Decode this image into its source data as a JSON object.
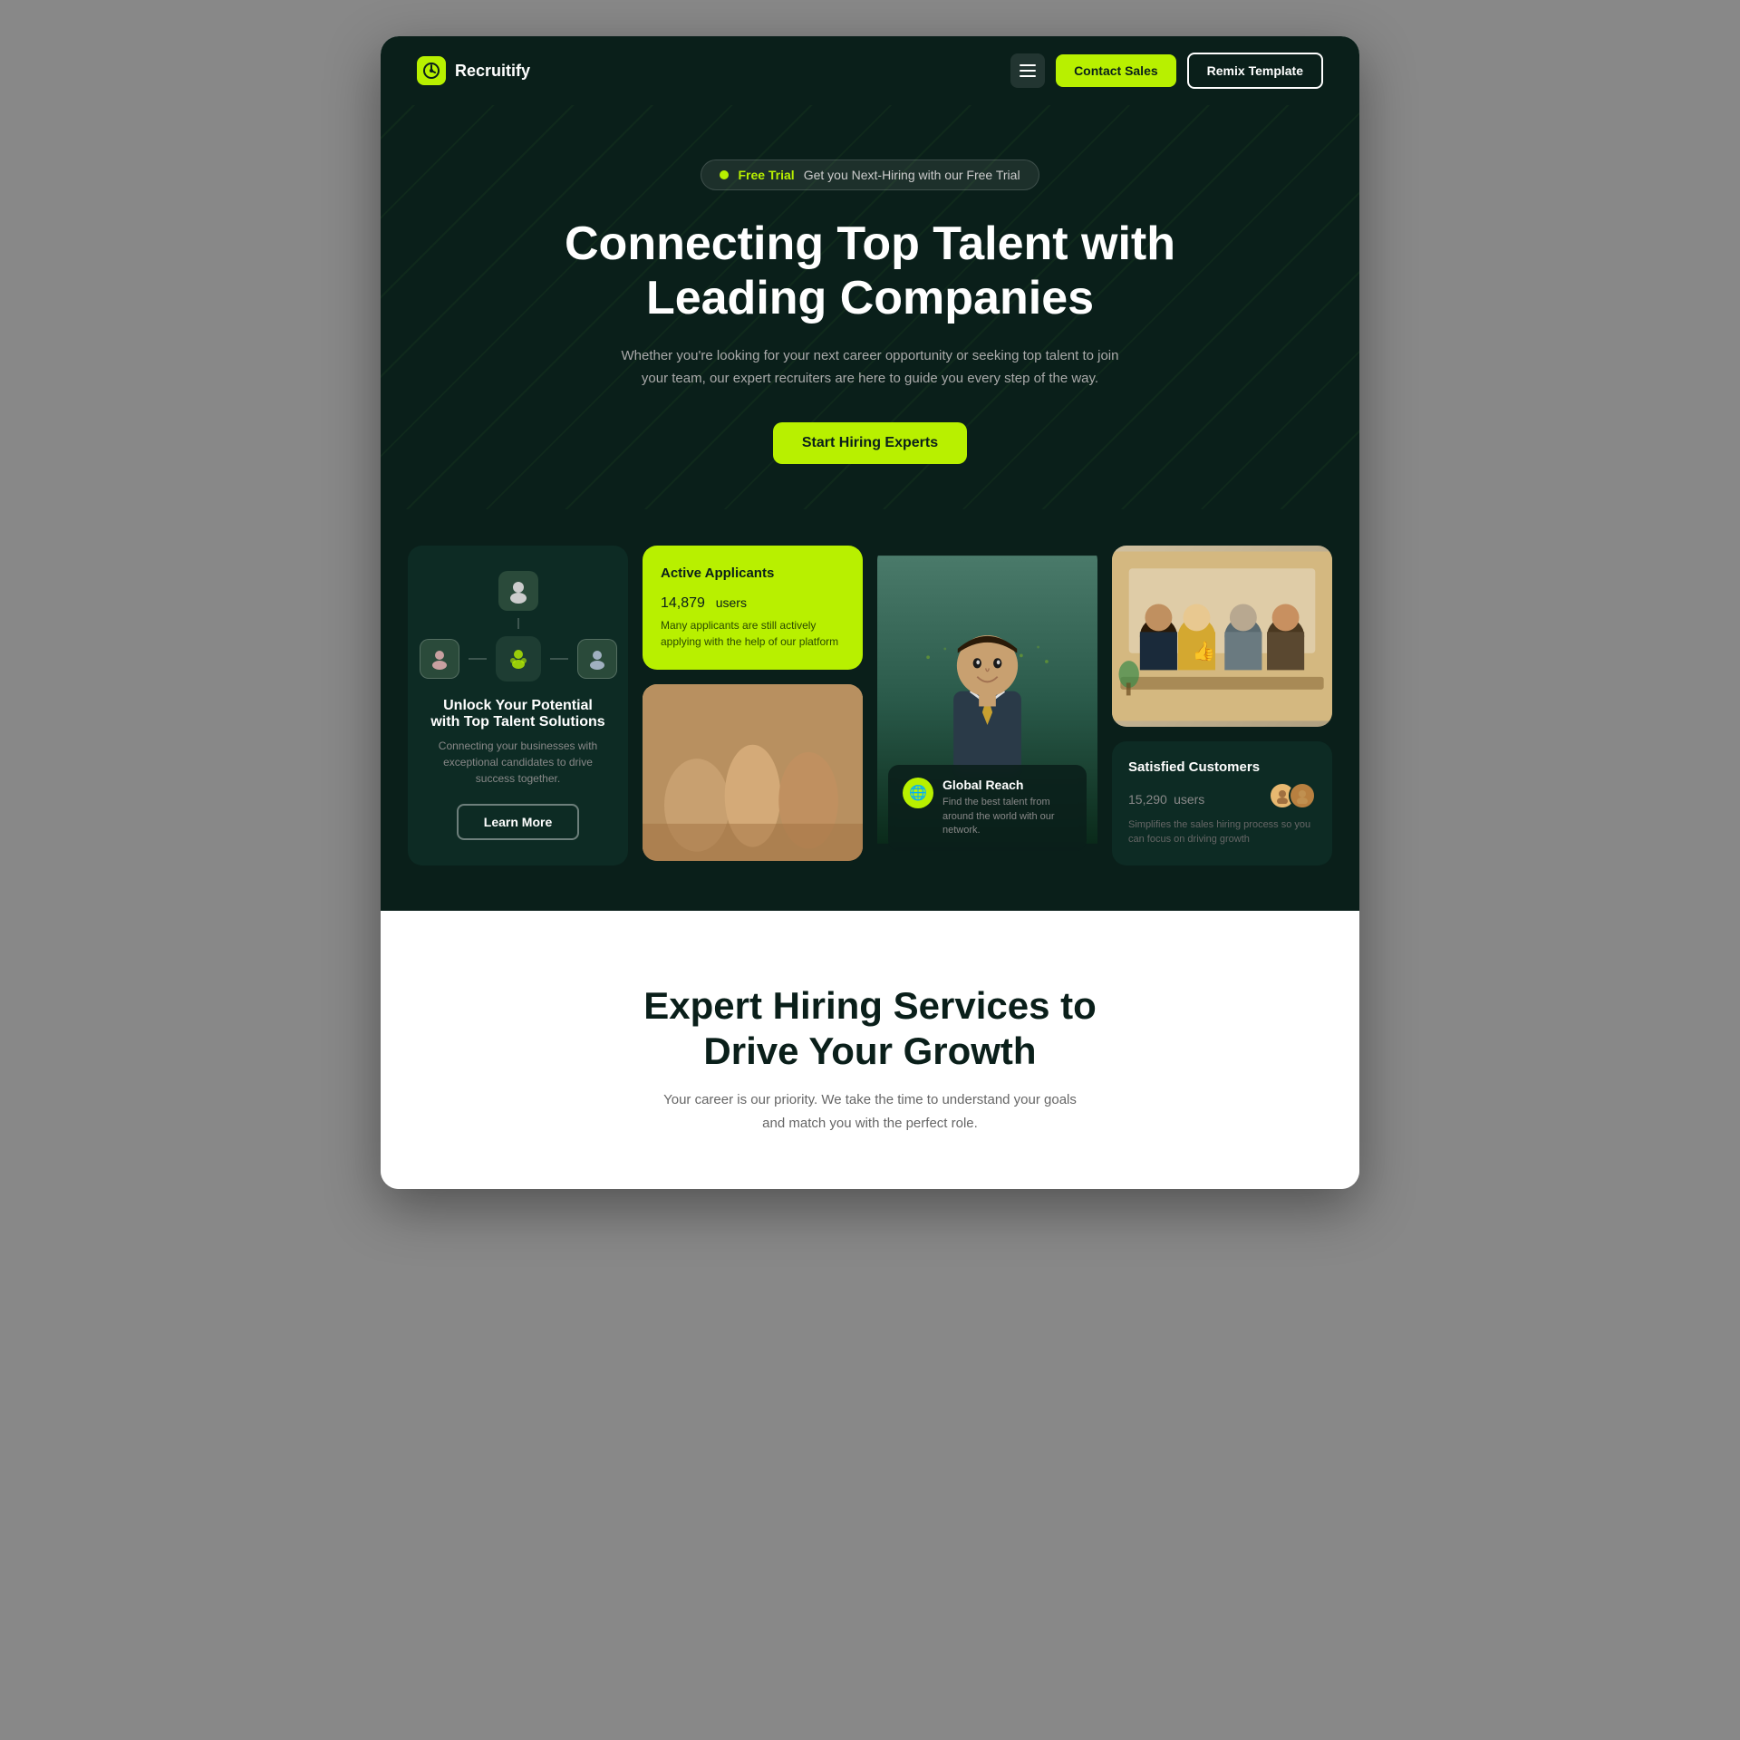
{
  "brand": {
    "logo_text": "Recruitify",
    "logo_icon": "📊"
  },
  "navbar": {
    "contact_sales": "Contact Sales",
    "remix_template": "Remix Template"
  },
  "hero": {
    "badge_label": "Free Trial",
    "badge_text": "Get you Next-Hiring with our Free Trial",
    "title_line1": "Connecting Top Talent with",
    "title_line2": "Leading Companies",
    "subtitle": "Whether you're looking for your next career opportunity or seeking top talent to join your team, our expert recruiters are here to guide you every step of the way.",
    "cta_button": "Start Hiring Experts"
  },
  "cards": {
    "card1": {
      "title": "Unlock Your Potential with Top Talent Solutions",
      "desc": "Connecting your businesses with exceptional candidates to drive success together.",
      "btn_label": "Learn More"
    },
    "card2": {
      "active_title": "Active Applicants",
      "active_count": "14,879",
      "active_users": "users",
      "active_desc": "Many applicants are still actively applying with the help of our platform"
    },
    "card3": {
      "global_title": "Global Reach",
      "global_desc": "Find the best talent from around the world with our network."
    },
    "card4": {
      "satisfied_title": "Satisfied Customers",
      "satisfied_count": "15,290",
      "satisfied_users": "users",
      "satisfied_desc": "Simplifies the sales hiring process so you can focus on driving growth"
    }
  },
  "services_section": {
    "title_line1": "Expert Hiring Services to",
    "title_line2": "Drive Your Growth",
    "desc": "Your career is our priority. We take the time to understand your goals and match you with the perfect role."
  }
}
